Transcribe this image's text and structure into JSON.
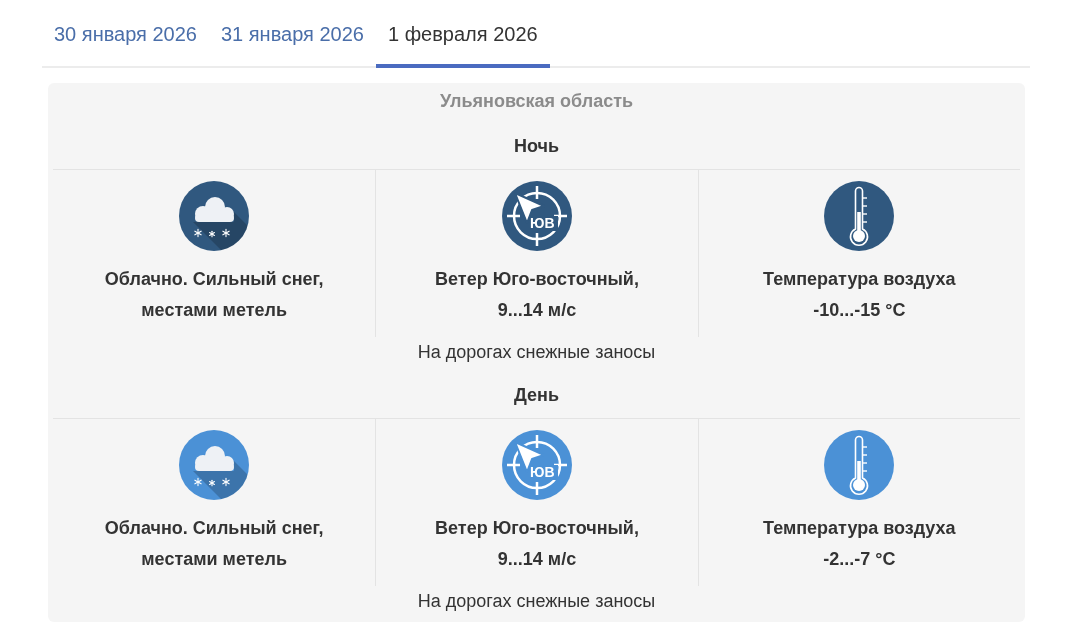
{
  "tabs": [
    {
      "label": "30 января 2026",
      "selected": false
    },
    {
      "label": "31 января 2026",
      "selected": false
    },
    {
      "label": "1 февраля 2026",
      "selected": true
    }
  ],
  "forecast": {
    "region": "Ульяновская область",
    "periods": [
      {
        "title": "Ночь",
        "color": "#30587f",
        "conditions": [
          {
            "kind": "sky",
            "lines": [
              "Облачно. Сильный снег,",
              "местами метель"
            ]
          },
          {
            "kind": "wind",
            "direction": "ЮВ",
            "lines": [
              "Ветер Юго-восточный,",
              "9...14 м/с"
            ]
          },
          {
            "kind": "temperature",
            "lines": [
              "Температура воздуха",
              "-10...-15 °C"
            ]
          }
        ],
        "road_note": "На дорогах снежные заносы"
      },
      {
        "title": "День",
        "color": "#4b91d6",
        "conditions": [
          {
            "kind": "sky",
            "lines": [
              "Облачно. Сильный снег,",
              "местами метель"
            ]
          },
          {
            "kind": "wind",
            "direction": "ЮВ",
            "lines": [
              "Ветер Юго-восточный,",
              "9...14 м/с"
            ]
          },
          {
            "kind": "temperature",
            "lines": [
              "Температура воздуха",
              "-2...-7 °C"
            ]
          }
        ],
        "road_note": "На дорогах снежные заносы"
      }
    ]
  }
}
